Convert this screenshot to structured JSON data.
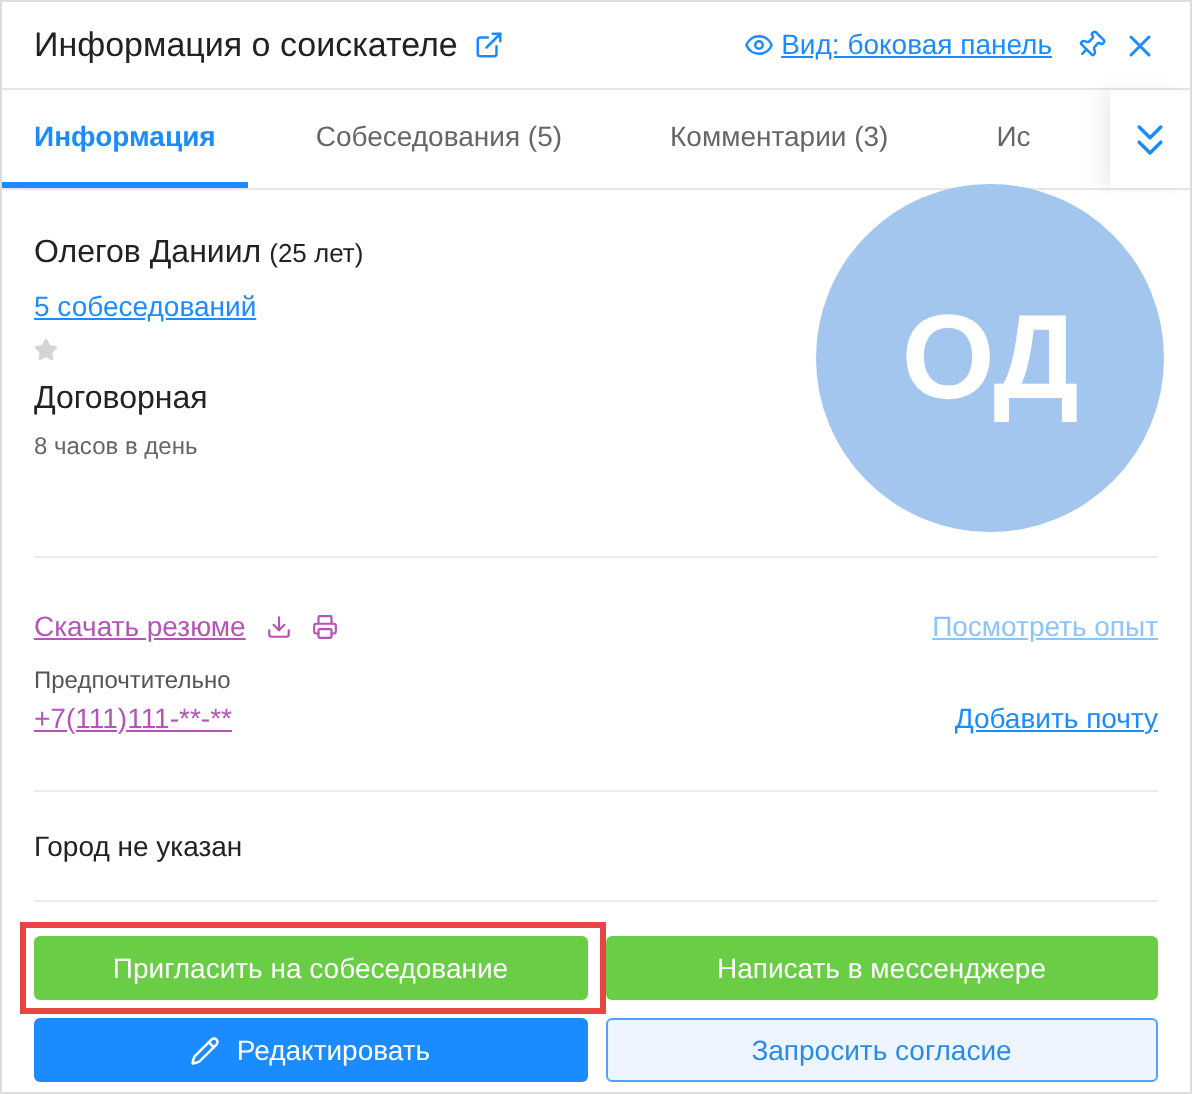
{
  "header": {
    "title": "Информация о соискателе",
    "view_link": "Вид: боковая панель"
  },
  "tabs": [
    {
      "label": "Информация",
      "selected": true
    },
    {
      "label": "Собеседования (5)",
      "selected": false
    },
    {
      "label": "Комментарии (3)",
      "selected": false
    },
    {
      "label": "Ис",
      "selected": false
    }
  ],
  "candidate": {
    "name": "Олегов Даниил",
    "age": "(25 лет)",
    "interviews_link": "5 собеседований",
    "favorite": false,
    "salary": "Договорная",
    "schedule": "8 часов в день",
    "initials": "ОД"
  },
  "contacts": {
    "resume_link": "Скачать резюме",
    "experience_link": "Посмотреть опыт",
    "preferred_label": "Предпочтительно",
    "phone": "+7(111)111-**-**",
    "add_email_link": "Добавить почту"
  },
  "city": "Город не указан",
  "buttons": [
    {
      "label": "Пригласить на собеседование",
      "kind": "green",
      "highlighted": true
    },
    {
      "label": "Написать в мессенджере",
      "kind": "green",
      "highlighted": false
    },
    {
      "label": "Редактировать",
      "kind": "primary",
      "highlighted": false
    },
    {
      "label": "Запросить согласие",
      "kind": "outline",
      "highlighted": false
    }
  ]
}
